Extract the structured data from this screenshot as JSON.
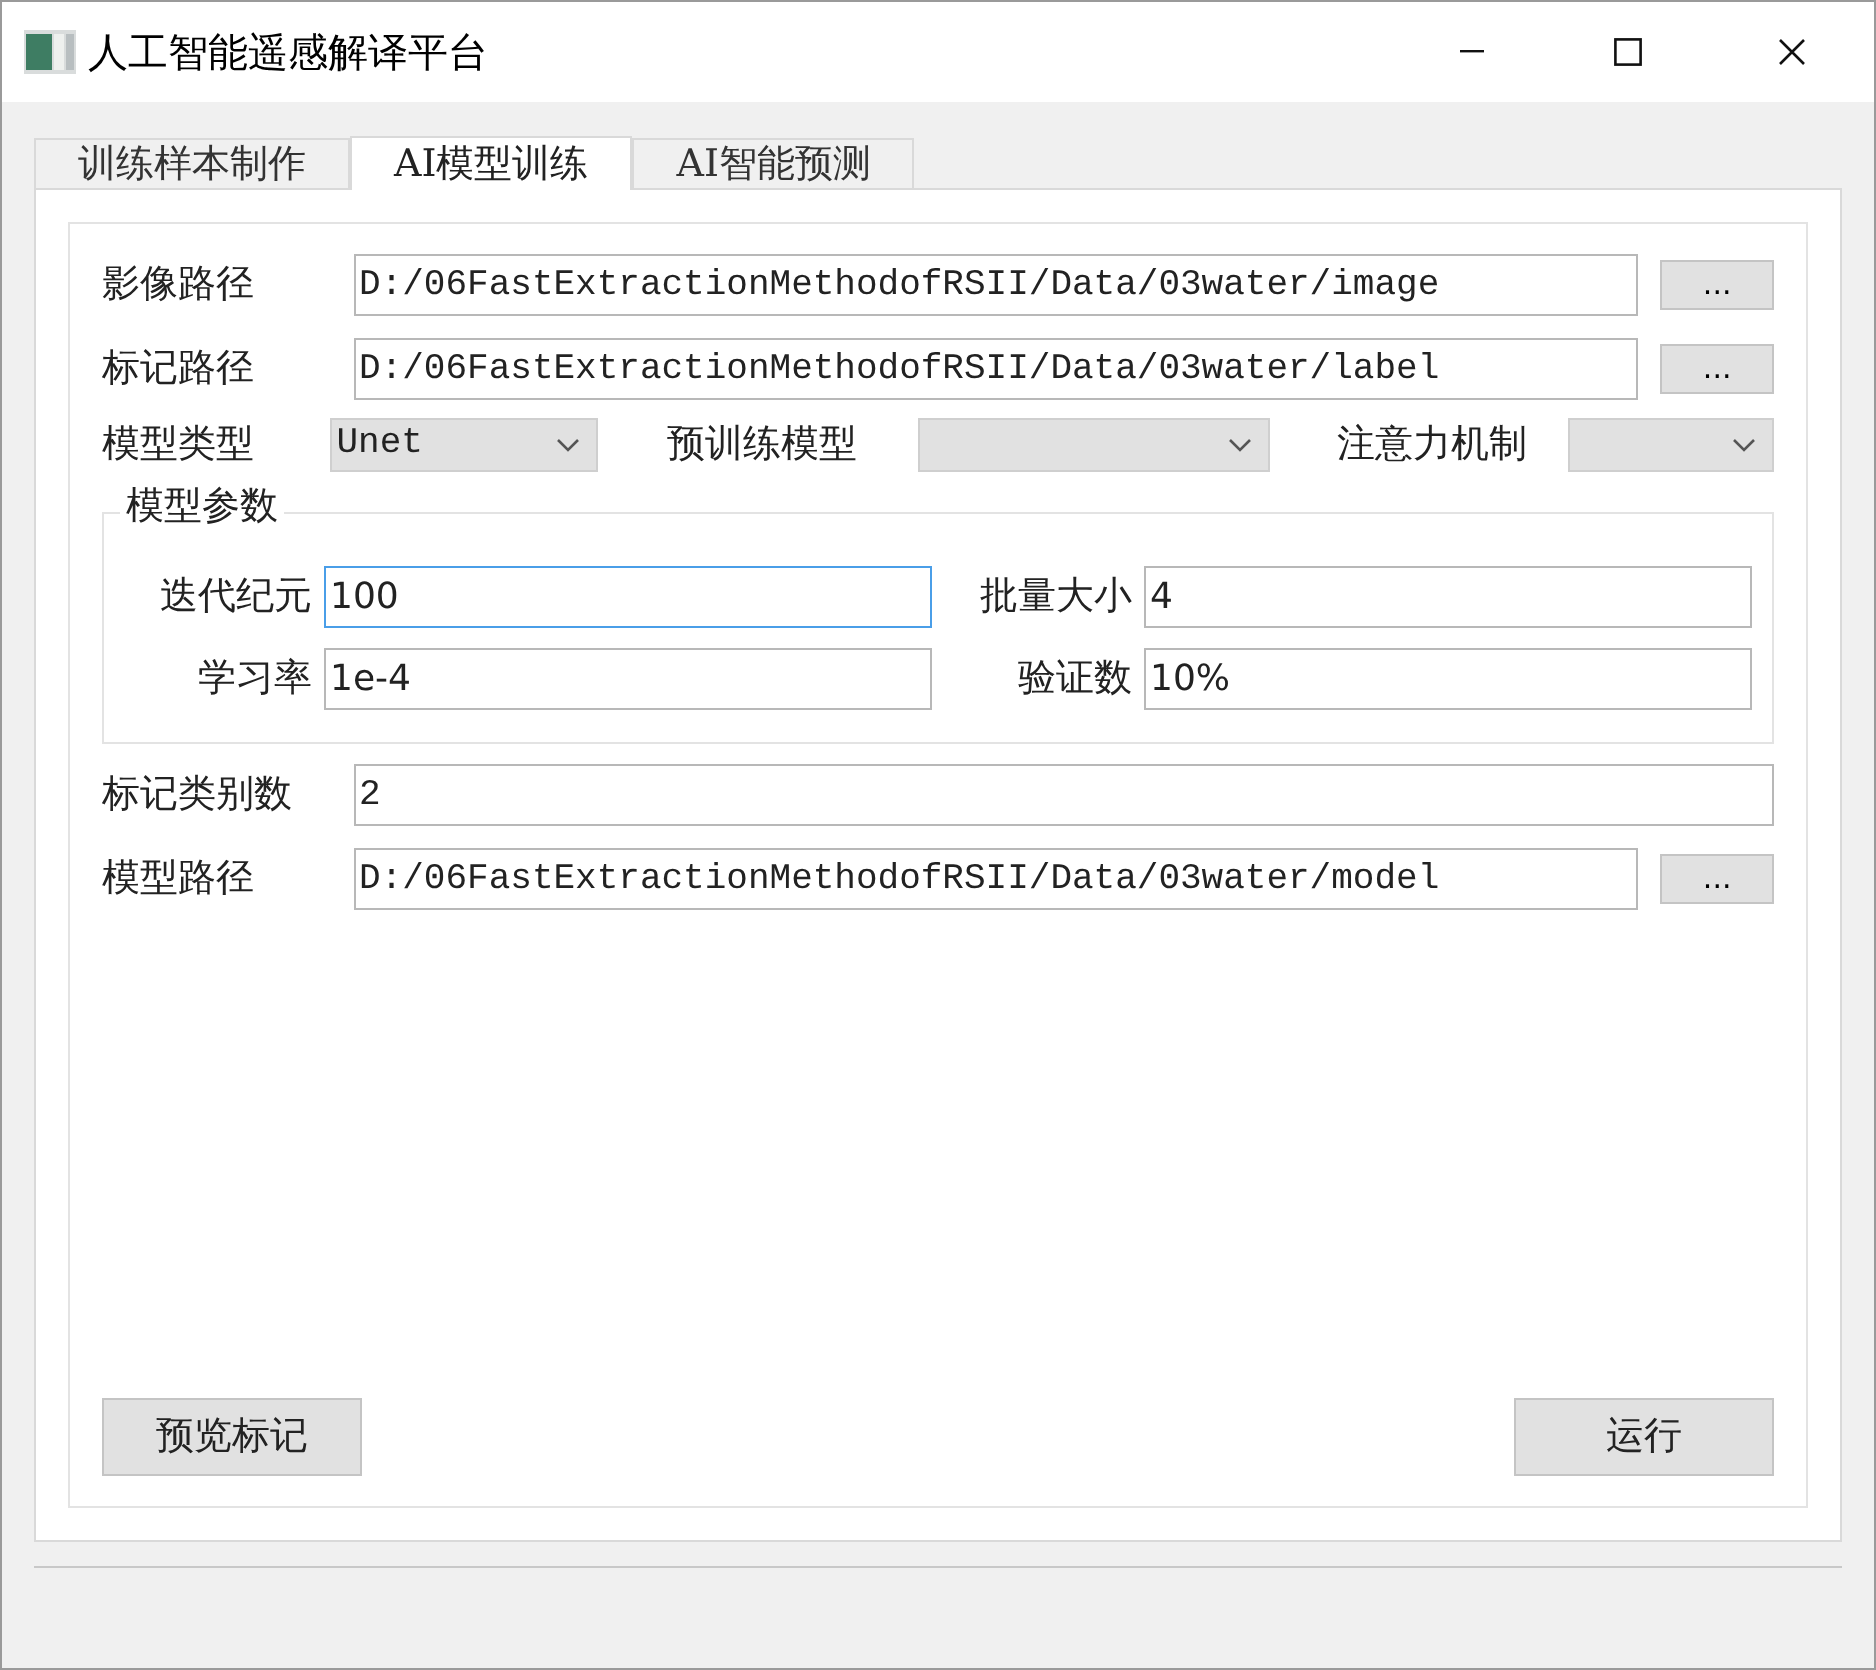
{
  "window": {
    "title": "人工智能遥感解译平台"
  },
  "tabs": [
    {
      "label": "训练样本制作",
      "selected": false
    },
    {
      "label": "AI模型训练",
      "selected": true
    },
    {
      "label": "AI智能预测",
      "selected": false
    }
  ],
  "image_path": {
    "label": "影像路径",
    "value": "D:/06FastExtractionMethodofRSII/Data/03water/image",
    "browse": "..."
  },
  "label_path": {
    "label": "标记路径",
    "value": "D:/06FastExtractionMethodofRSII/Data/03water/label",
    "browse": "..."
  },
  "model_options": [
    {
      "label": "模型类型",
      "value": "Unet"
    },
    {
      "label": "预训练模型"
    },
    {
      "label": "注意力机制"
    }
  ],
  "model_params": {
    "title": "模型参数",
    "fields": [
      {
        "label": "迭代纪元",
        "value": "100",
        "focused": true
      },
      {
        "label": "批量大小",
        "value": "4",
        "focused": false
      },
      {
        "label": "学习率",
        "value": "1e-4",
        "focused": false
      },
      {
        "label": "验证数",
        "value": "10%",
        "focused": false
      }
    ]
  },
  "class_count": {
    "label": "标记类别数",
    "value": "2"
  },
  "model_path": {
    "label": "模型路径",
    "value": "D:/06FastExtractionMethodofRSII/Data/03water/model",
    "browse": "..."
  },
  "buttons": [
    "预览标记",
    "运行"
  ]
}
